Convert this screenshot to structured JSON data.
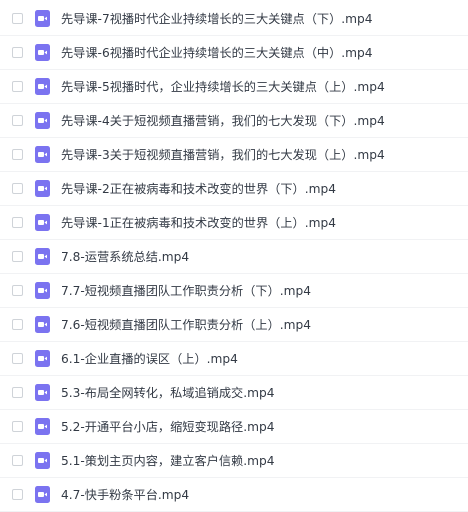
{
  "file_list": {
    "icon": "video-file-icon",
    "icon_color": "#7b73f0",
    "items": [
      {
        "name": "先导课-7视播时代企业持续增长的三大关键点（下）.mp4"
      },
      {
        "name": "先导课-6视播时代企业持续增长的三大关键点（中）.mp4"
      },
      {
        "name": "先导课-5视播时代，企业持续增长的三大关键点（上）.mp4"
      },
      {
        "name": "先导课-4关于短视频直播营销，我们的七大发现（下）.mp4"
      },
      {
        "name": "先导课-3关于短视频直播营销，我们的七大发现（上）.mp4"
      },
      {
        "name": "先导课-2正在被病毒和技术改变的世界（下）.mp4"
      },
      {
        "name": "先导课-1正在被病毒和技术改变的世界（上）.mp4"
      },
      {
        "name": "7.8-运营系统总结.mp4"
      },
      {
        "name": "7.7-短视频直播团队工作职责分析（下）.mp4"
      },
      {
        "name": "7.6-短视频直播团队工作职责分析（上）.mp4"
      },
      {
        "name": "6.1-企业直播的误区（上）.mp4"
      },
      {
        "name": "5.3-布局全网转化，私域追销成交.mp4"
      },
      {
        "name": "5.2-开通平台小店，缩短变现路径.mp4"
      },
      {
        "name": "5.1-策划主页内容，建立客户信赖.mp4"
      },
      {
        "name": "4.7-快手粉条平台.mp4"
      }
    ]
  }
}
